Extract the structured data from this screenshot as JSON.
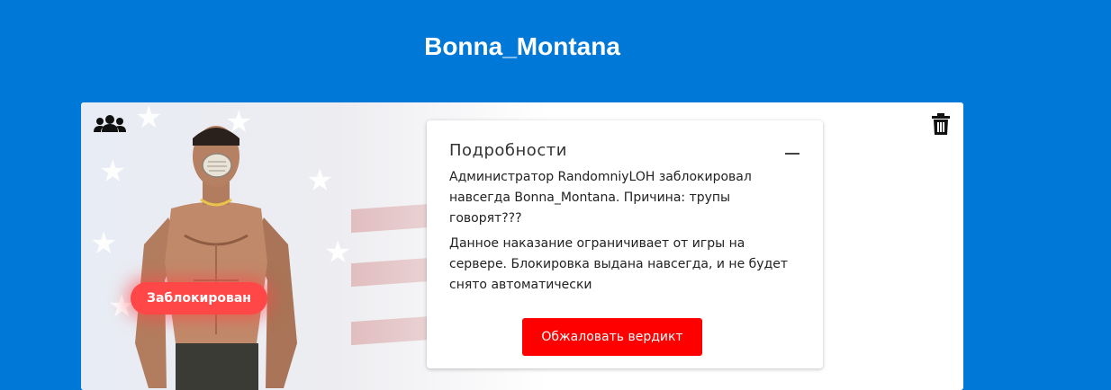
{
  "header": {
    "username": "Bonna_Montana"
  },
  "card": {
    "status_badge": "Заблокирован",
    "icons": {
      "group": "users-group-icon",
      "delete": "trash-icon"
    }
  },
  "details": {
    "title": "Подробности",
    "paragraph_1": "Администратор RandomniyLOH заблокировал навсегда Bonna_Montana. Причина: трупы говорят???",
    "paragraph_2": "Данное наказание ограничивает от игры на сервере. Блокировка выдана навсегда, и не будет снято автоматически",
    "appeal_button": "Обжаловать вердикт"
  },
  "colors": {
    "background": "#0078d7",
    "badge": "#ff4747",
    "appeal_button": "#ff0000"
  }
}
